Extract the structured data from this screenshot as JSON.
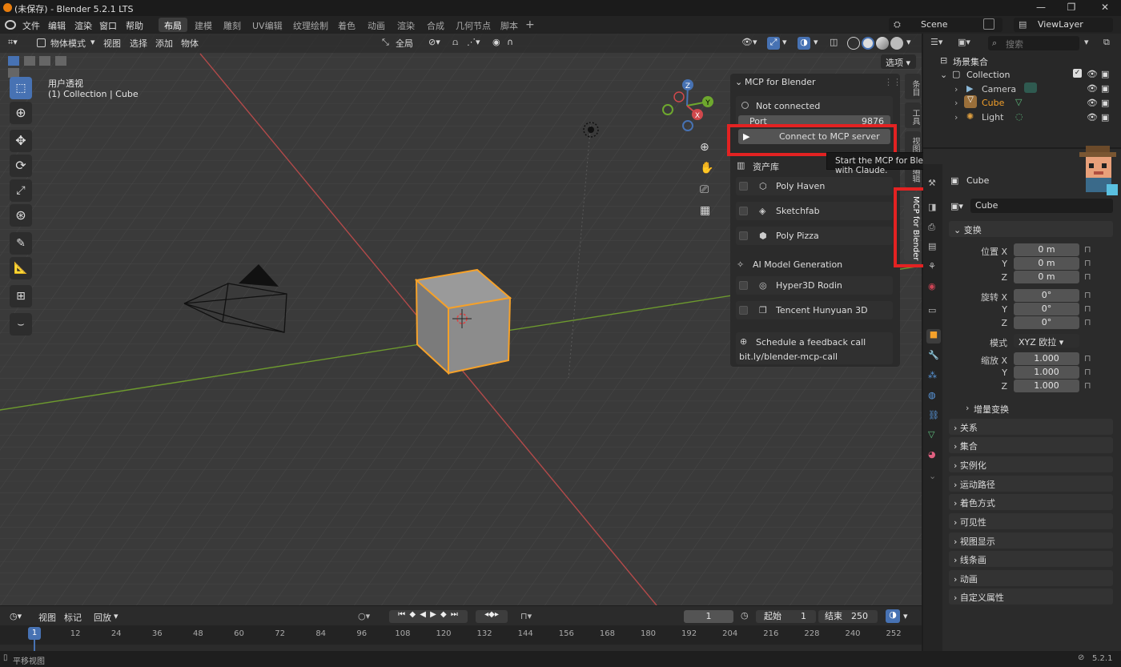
{
  "window": {
    "title": "(未保存) - Blender 5.2.1 LTS"
  },
  "menu": [
    "文件",
    "编辑",
    "渲染",
    "窗口",
    "帮助"
  ],
  "workspaces": [
    "布局",
    "建模",
    "雕刻",
    "UV编辑",
    "纹理绘制",
    "着色",
    "动画",
    "渲染",
    "合成",
    "几何节点",
    "脚本"
  ],
  "scene": {
    "name": "Scene",
    "view_layer": "ViewLayer"
  },
  "viewport_header": {
    "mode": "物体模式",
    "menus": [
      "视图",
      "选择",
      "添加",
      "物体"
    ],
    "transform_orientation": "全局",
    "options": "选项"
  },
  "viewport_info": {
    "view": "用户透视",
    "context": "(1) Collection | Cube"
  },
  "mcp_panel": {
    "title": "MCP for Blender",
    "status": "Not connected",
    "port_label": "Port",
    "port_value": "9876",
    "connect_button": "Connect to MCP server",
    "assets_title": "资产库",
    "assets": [
      "Poly Haven",
      "Sketchfab",
      "Poly Pizza"
    ],
    "ai_title": "AI Model Generation",
    "ai_items": [
      "Hyper3D Rodin",
      "Tencent Hunyuan 3D"
    ],
    "feedback_title": "Schedule a feedback call",
    "feedback_link": "bit.ly/blender-mcp-call"
  },
  "side_tabs": [
    "条目",
    "工具",
    "视图",
    "编辑",
    "MCP for Blender"
  ],
  "tooltip": "Start the MCP for Blender server to connect with Claude.",
  "outliner": {
    "search_placeholder": "搜索",
    "root": "场景集合",
    "collection": "Collection",
    "objects": [
      "Camera",
      "Cube",
      "Light"
    ]
  },
  "properties": {
    "object_name": "Cube",
    "data_name": "Cube",
    "transform_title": "变换",
    "location_labels": [
      "位置 X",
      "Y",
      "Z"
    ],
    "location_values": [
      "0 m",
      "0 m",
      "0 m"
    ],
    "rotation_labels": [
      "旋转 X",
      "Y",
      "Z"
    ],
    "rotation_values": [
      "0°",
      "0°",
      "0°"
    ],
    "mode_label": "模式",
    "mode_value": "XYZ 欧拉",
    "scale_labels": [
      "缩放 X",
      "Y",
      "Z"
    ],
    "scale_values": [
      "1.000",
      "1.000",
      "1.000"
    ],
    "delta_transform": "增量变换",
    "panels": [
      "关系",
      "集合",
      "实例化",
      "运动路径",
      "着色方式",
      "可见性",
      "视图显示",
      "线条画",
      "动画",
      "自定义属性"
    ]
  },
  "timeline": {
    "menus": [
      "视图",
      "标记",
      "回放"
    ],
    "current_frame": "1",
    "start_label": "起始",
    "start_value": "1",
    "end_label": "结束",
    "end_value": "250",
    "ticks": [
      "1",
      "12",
      "24",
      "36",
      "48",
      "60",
      "72",
      "84",
      "96",
      "108",
      "120",
      "132",
      "144",
      "156",
      "168",
      "180",
      "192",
      "204",
      "216",
      "228",
      "240",
      "252"
    ]
  },
  "status": {
    "left": "平移视图",
    "version": "5.2.1"
  },
  "colors": {
    "accent": "#4772b3",
    "selection": "#f5a12a",
    "highlight": "#e32222"
  }
}
